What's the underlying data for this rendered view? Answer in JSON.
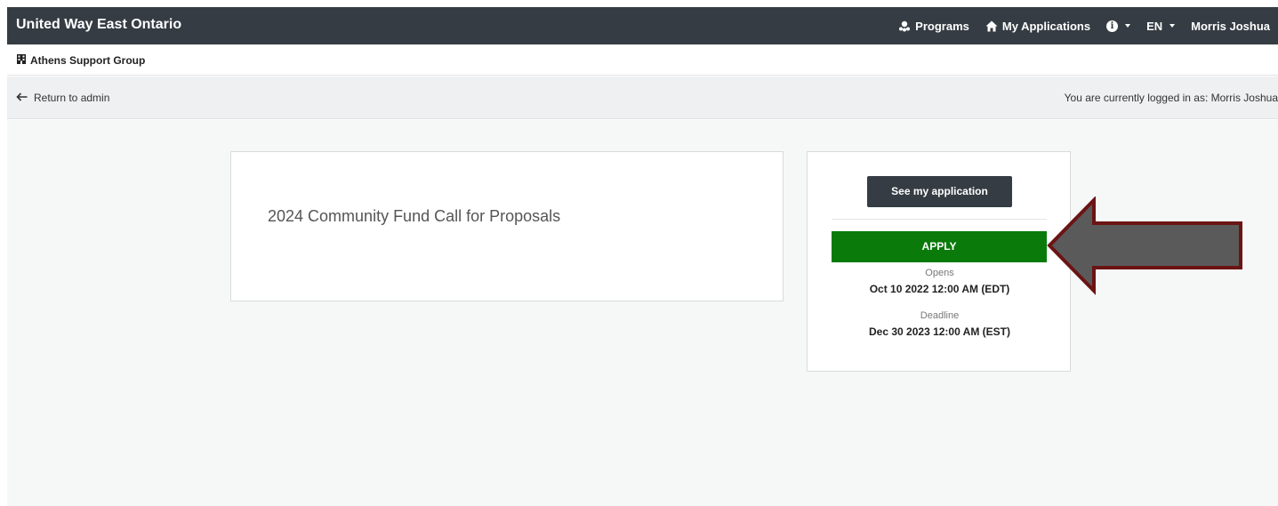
{
  "header": {
    "brand": "United Way East Ontario",
    "nav": {
      "programs": "Programs",
      "my_applications": "My Applications",
      "language": "EN",
      "user": "Morris Joshua"
    }
  },
  "org": {
    "name": "Athens Support Group"
  },
  "admin_bar": {
    "return_label": "Return to admin",
    "logged_in_text": "You are currently logged in as: Morris Joshua"
  },
  "program": {
    "title": "2024 Community Fund Call for Proposals"
  },
  "actions": {
    "see_application": "See my application",
    "apply": "APPLY",
    "opens_label": "Opens",
    "opens_value": "Oct 10 2022 12:00 AM (EDT)",
    "deadline_label": "Deadline",
    "deadline_value": "Dec 30 2023 12:00 AM (EST)"
  },
  "colors": {
    "navbar": "#353c43",
    "apply": "#0a7a0a",
    "annotation_arrow_fill": "#5a5a5a",
    "annotation_arrow_stroke": "#6b1414"
  }
}
